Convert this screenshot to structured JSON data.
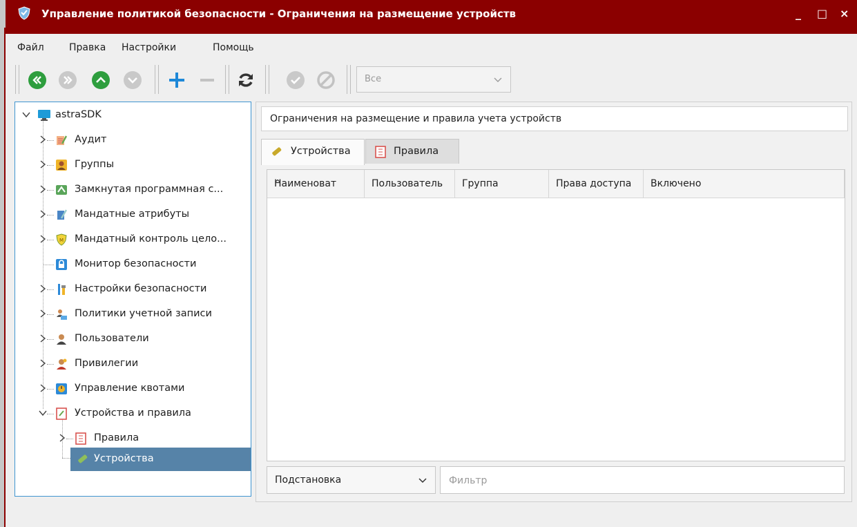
{
  "window": {
    "title": "Управление политикой безопасности - Ограничения на размещение устройств",
    "minimize": "_",
    "maximize": "□",
    "close": "×"
  },
  "menu": [
    "Файл",
    "Правка",
    "Настройки",
    "Помощь"
  ],
  "toolbar": {
    "filter_combo": {
      "value": "Все"
    }
  },
  "tree": {
    "root": "astraSDK",
    "items": [
      {
        "label": "Аудит",
        "icon": "audit-icon"
      },
      {
        "label": "Группы",
        "icon": "groups-icon"
      },
      {
        "label": "Замкнутая программная с...",
        "icon": "closed-software-icon"
      },
      {
        "label": "Мандатные атрибуты",
        "icon": "mandatory-attributes-icon"
      },
      {
        "label": "Мандатный контроль цело...",
        "icon": "integrity-control-icon"
      },
      {
        "label": "Монитор безопасности",
        "icon": "lock-icon"
      },
      {
        "label": "Настройки безопасности",
        "icon": "tools-icon"
      },
      {
        "label": "Политики учетной записи",
        "icon": "account-policy-icon"
      },
      {
        "label": "Пользователи",
        "icon": "users-icon"
      },
      {
        "label": "Привилегии",
        "icon": "privileges-icon"
      },
      {
        "label": "Управление квотами",
        "icon": "quota-icon"
      },
      {
        "label": "Устройства и правила",
        "icon": "devices-rules-icon"
      }
    ],
    "children": [
      {
        "label": "Правила",
        "icon": "rules-icon"
      },
      {
        "label": "Устройства",
        "icon": "devices-icon"
      }
    ]
  },
  "content": {
    "description": "Ограничения на размещение и правила учета устройств",
    "tabs": [
      {
        "label": "Устройства"
      },
      {
        "label": "Правила"
      }
    ],
    "table": {
      "columns": [
        "Наименоват",
        "Пользователь",
        "Группа",
        "Права доступа",
        "Включено"
      ],
      "rows": []
    },
    "substitution": {
      "value": "Подстановка"
    },
    "filter": {
      "placeholder": "Фильтр",
      "value": ""
    }
  },
  "colors": {
    "titlebar": "#8b0000",
    "selection": "#5683a8",
    "accent_green": "#2e9e3e",
    "accent_blue": "#1e88d8"
  }
}
